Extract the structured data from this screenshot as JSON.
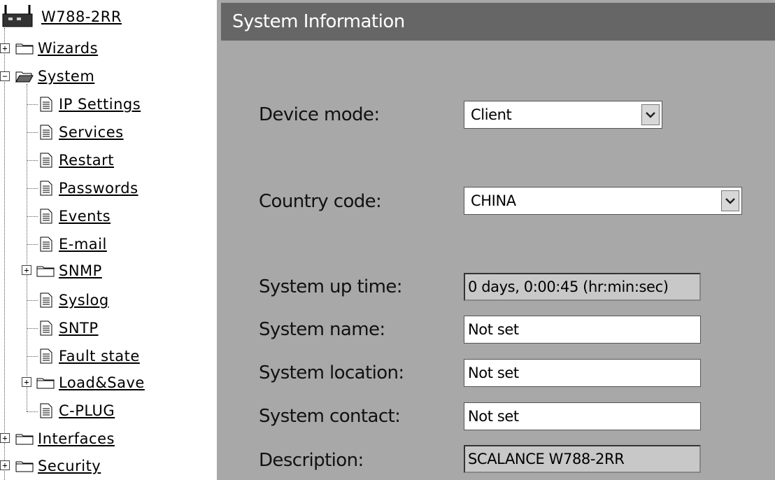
{
  "tree": {
    "root": {
      "label": "W788-2RR",
      "icon": "router-icon"
    },
    "items": [
      {
        "label": "Wizards",
        "type": "folder",
        "expander": "+"
      },
      {
        "label": "System",
        "type": "folder-open",
        "expander": "−"
      },
      {
        "label": "IP Settings",
        "type": "page"
      },
      {
        "label": "Services",
        "type": "page"
      },
      {
        "label": "Restart",
        "type": "page"
      },
      {
        "label": "Passwords",
        "type": "page"
      },
      {
        "label": "Events",
        "type": "page"
      },
      {
        "label": "E-mail",
        "type": "page"
      },
      {
        "label": "SNMP",
        "type": "folder",
        "expander": "+"
      },
      {
        "label": "Syslog",
        "type": "page"
      },
      {
        "label": "SNTP",
        "type": "page"
      },
      {
        "label": "Fault state",
        "type": "page"
      },
      {
        "label": "Load&Save",
        "type": "folder",
        "expander": "+"
      },
      {
        "label": "C-PLUG",
        "type": "page"
      },
      {
        "label": "Interfaces",
        "type": "folder",
        "expander": "+"
      },
      {
        "label": "Security",
        "type": "folder",
        "expander": "+"
      }
    ]
  },
  "panel": {
    "title": "System Information",
    "device_mode": {
      "label": "Device mode:",
      "value": "Client"
    },
    "country_code": {
      "label": "Country code:",
      "value": "CHINA"
    },
    "up_time": {
      "label": "System up time:",
      "value": "0 days,  0:00:45 (hr:min:sec)"
    },
    "system_name": {
      "label": "System name:",
      "value": "Not set"
    },
    "system_location": {
      "label": "System location:",
      "value": "Not set"
    },
    "system_contact": {
      "label": "System contact:",
      "value": "Not set"
    },
    "description": {
      "label": "Description:",
      "value": "SCALANCE W788-2RR"
    }
  },
  "colors": {
    "panel_bg": "#a8a8a8",
    "header_bg": "#666666",
    "header_text": "#ffffff",
    "readonly_bg": "#c8c8c8"
  }
}
